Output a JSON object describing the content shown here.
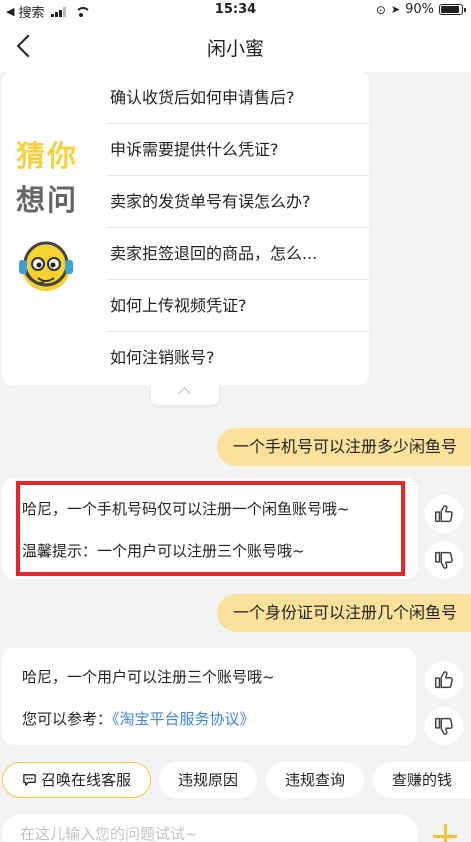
{
  "status_bar": {
    "carrier": "搜索",
    "time": "15:34",
    "battery": "90%",
    "battery_level": 0.9
  },
  "header": {
    "title": "闲小蜜"
  },
  "faq": {
    "guess_line1": "猜你",
    "guess_line2": "想问",
    "items": [
      "确认收货后如何申请售后?",
      "申诉需要提供什么凭证?",
      "卖家的发货单号有误怎么办?",
      "卖家拒签退回的商品，怎么...",
      "如何上传视频凭证?",
      "如何注销账号?"
    ]
  },
  "messages": {
    "user1": "一个手机号可以注册多少闲鱼号",
    "bot1_line1": "哈尼，一个手机号码仅可以注册一个闲鱼账号哦~",
    "bot1_line2": "温馨提示：一个用户可以注册三个账号哦~",
    "user2": "一个身份证可以注册几个闲鱼号",
    "bot2_line1": "哈尼，一个用户可以注册三个账号哦~",
    "bot2_ref_prefix": "您可以参考：",
    "bot2_ref_link": "《淘宝平台服务协议》"
  },
  "shortcuts": {
    "chips": [
      "召唤在线客服",
      "违规原因",
      "违规查询",
      "查赚的钱"
    ]
  },
  "input": {
    "placeholder": "在这儿输入您的问题试试~"
  },
  "colors": {
    "accent_yellow": "#fbe19a",
    "highlight_red": "#e8262a",
    "link_blue": "#3d87e6"
  }
}
